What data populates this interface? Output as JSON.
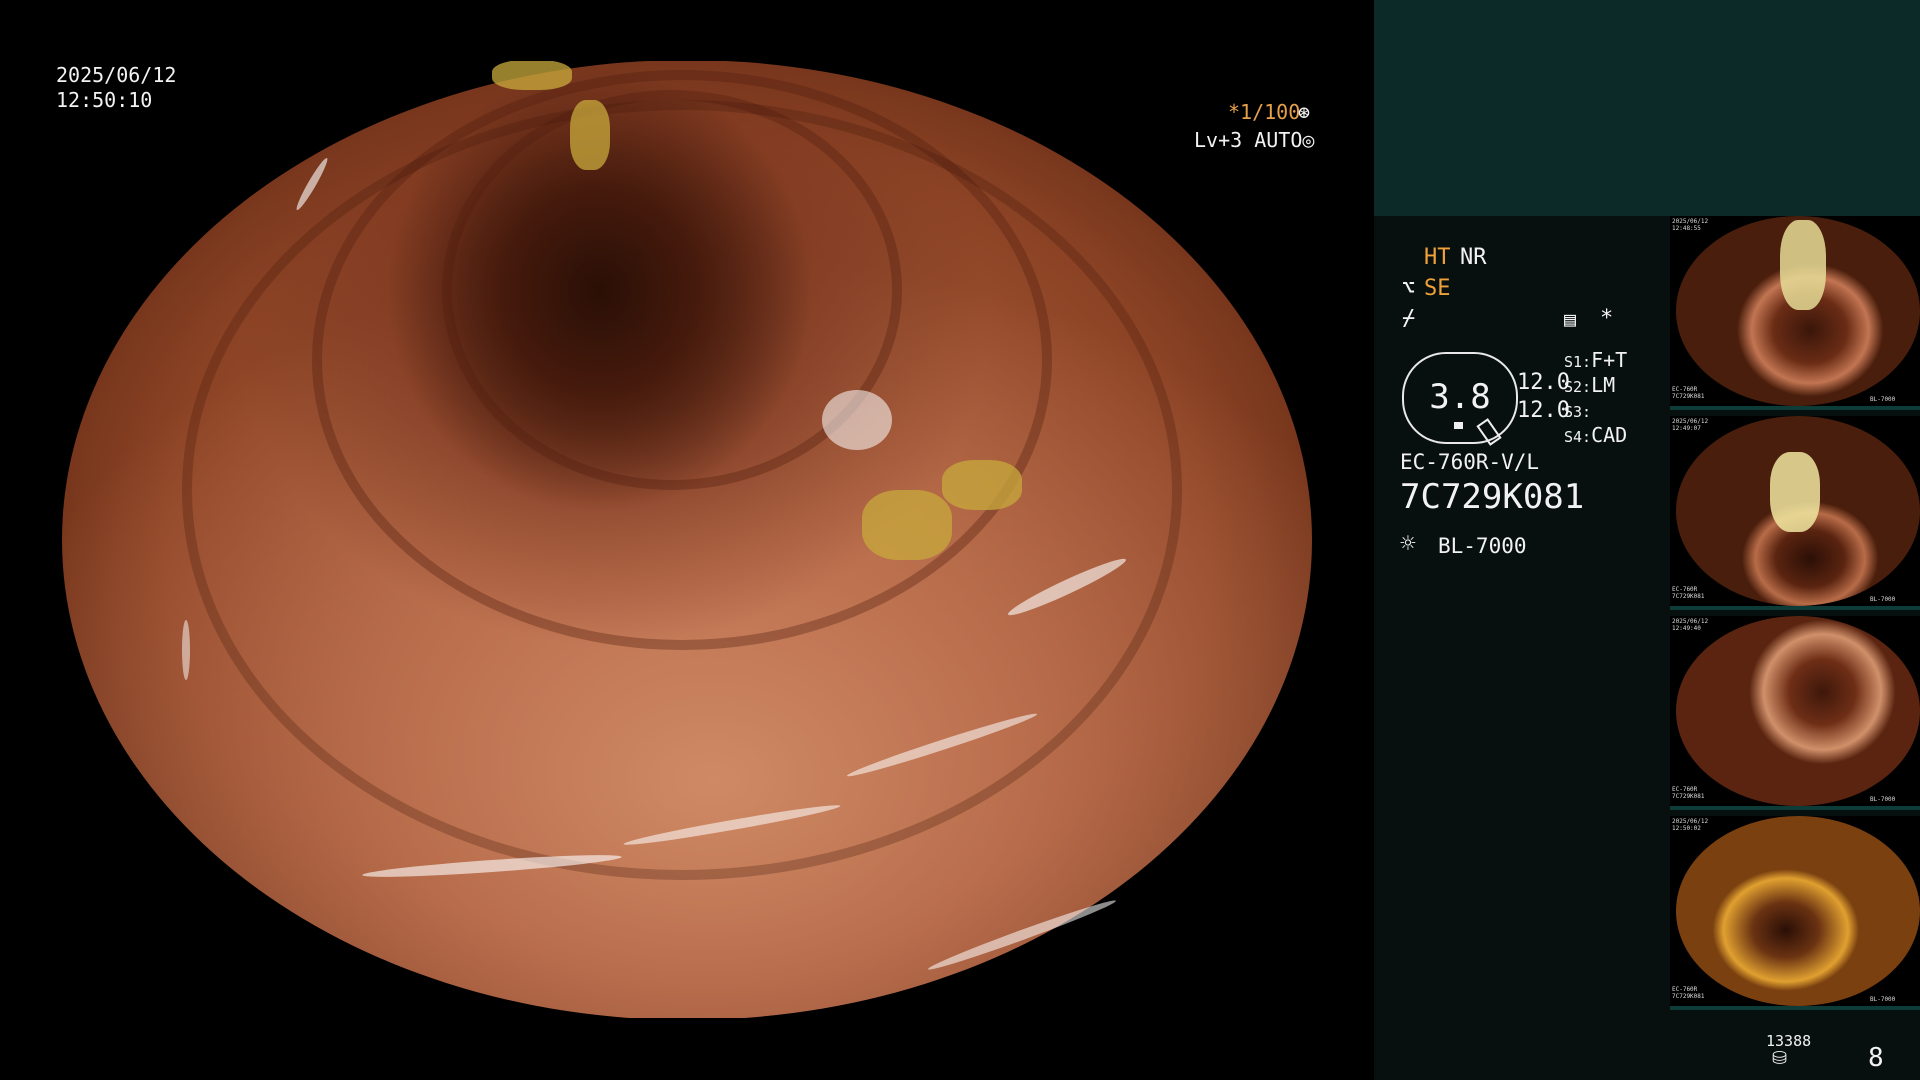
{
  "osd": {
    "date": "2025/06/12",
    "time": "12:50:10",
    "shutter": "*1/100",
    "shutter_icon": "⊛",
    "enhance": "Lv+3 AUTO",
    "enhance_icon": "◎"
  },
  "panel": {
    "ht": "HT",
    "nr": "NR",
    "se_icon": "⌥",
    "se": "SE",
    "sig_icon": "⌿",
    "menu_icon": "▤",
    "star": "*",
    "zoom": "3.8",
    "num_a": "12.0",
    "num_b": "12.0",
    "s1_key": "S1:",
    "s1_val": "F+T",
    "s2_key": "S2:",
    "s2_val": "LM",
    "s3_key": "S3:",
    "s3_val": "",
    "s4_key": "S4:",
    "s4_val": "CAD",
    "scope_model": "EC-760R-V/L",
    "serial": "7C729K081",
    "light_icon": "☼",
    "light_source": "BL-7000",
    "storage_count": "13388",
    "storage_icon": "⛁",
    "image_count": "8"
  },
  "thumbnails": [
    {
      "line1": "2025/06/12\n12:48:55",
      "line2": "EC-760R\n7C729K081",
      "badge": "BL-7000"
    },
    {
      "line1": "2025/06/12\n12:49:07",
      "line2": "EC-760R\n7C729K081",
      "badge": "BL-7000"
    },
    {
      "line1": "2025/06/12\n12:49:40",
      "line2": "EC-760R\n7C729K081",
      "badge": "BL-7000"
    },
    {
      "line1": "2025/06/12\n12:50:02",
      "line2": "EC-760R\n7C729K081",
      "badge": "BL-7000"
    }
  ],
  "colors": {
    "panel_bg": "#07100f",
    "panel_header": "#0b2a28",
    "accent_orange": "#f0a23a"
  }
}
